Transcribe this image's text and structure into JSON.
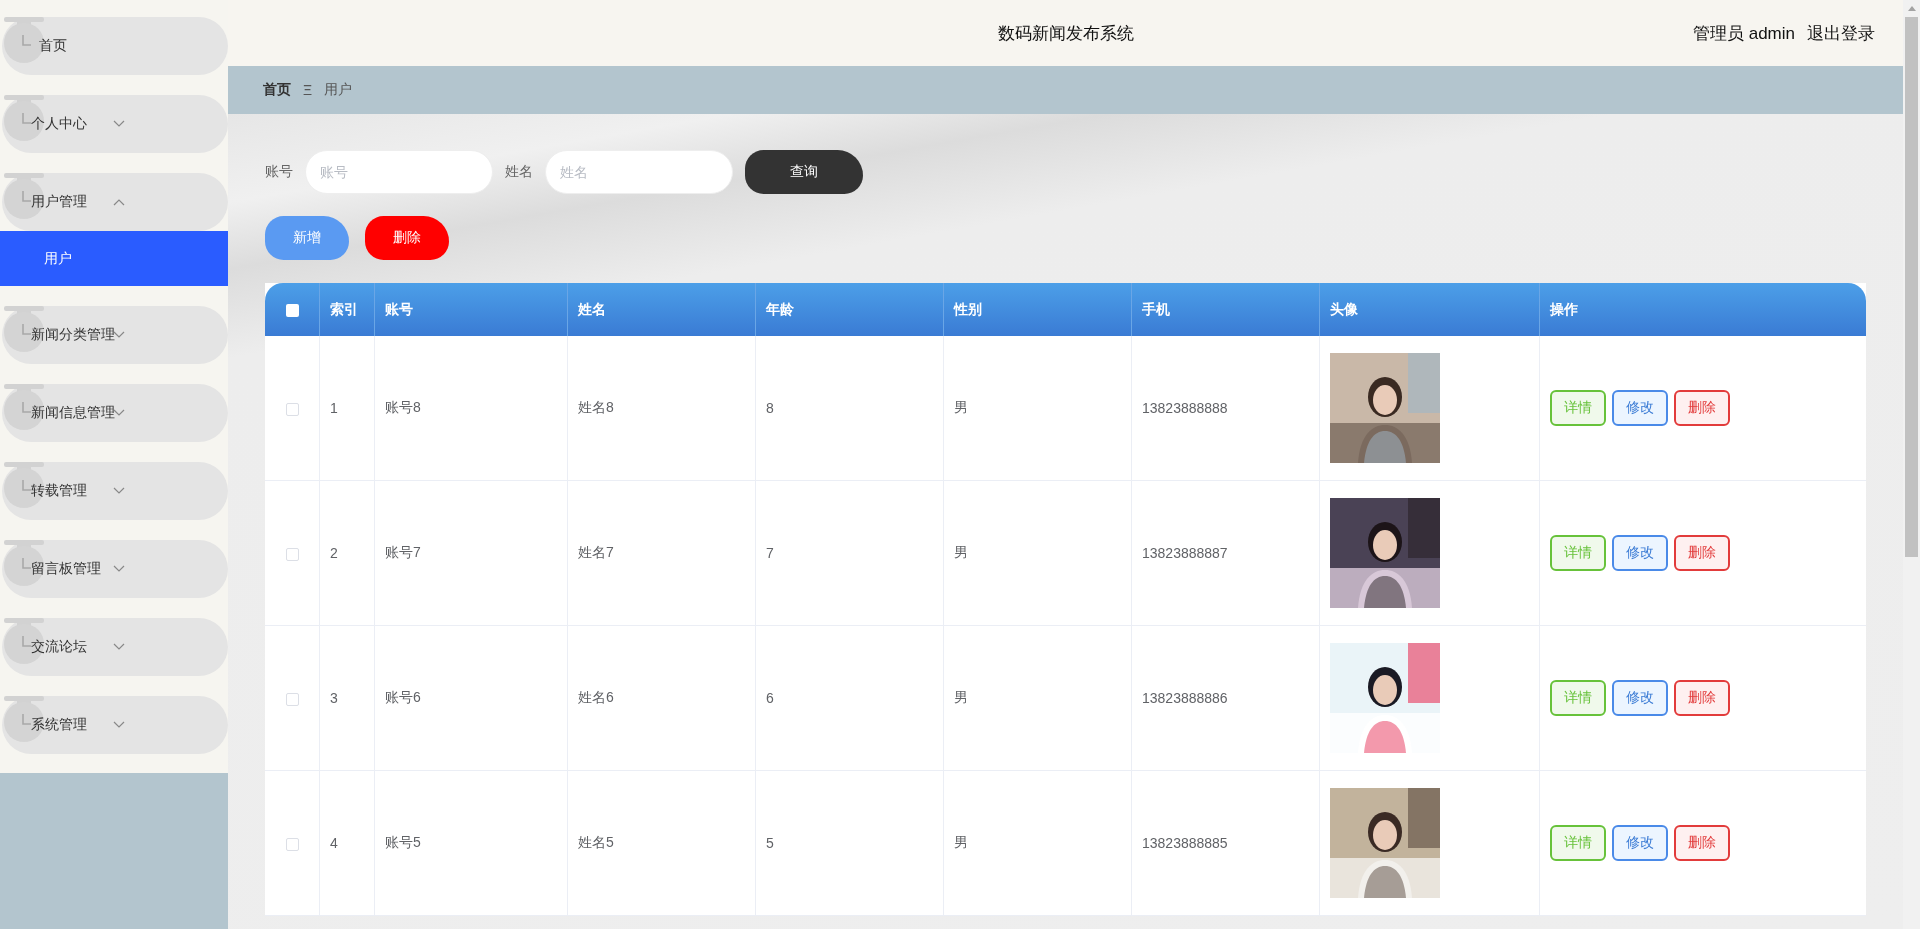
{
  "sidebar": {
    "items": [
      {
        "label": "首页",
        "kind": "link"
      },
      {
        "label": "个人中心",
        "kind": "submenu",
        "expanded": false
      },
      {
        "label": "用户管理",
        "kind": "submenu",
        "expanded": true,
        "children": [
          {
            "label": "用户",
            "selected": true
          }
        ]
      },
      {
        "label": "新闻分类管理",
        "kind": "submenu",
        "expanded": false
      },
      {
        "label": "新闻信息管理",
        "kind": "submenu",
        "expanded": false
      },
      {
        "label": "转载管理",
        "kind": "submenu",
        "expanded": false
      },
      {
        "label": "留言板管理",
        "kind": "submenu",
        "expanded": false
      },
      {
        "label": "交流论坛",
        "kind": "submenu",
        "expanded": false
      },
      {
        "label": "系统管理",
        "kind": "submenu",
        "expanded": false
      }
    ]
  },
  "header": {
    "title": "数码新闻发布系统",
    "user": "管理员 admin",
    "logout": "退出登录"
  },
  "breadcrumb": {
    "items": [
      "首页",
      "用户"
    ],
    "separator": "Ξ"
  },
  "search": {
    "fields": [
      {
        "label": "账号",
        "placeholder": "账号"
      },
      {
        "label": "姓名",
        "placeholder": "姓名"
      }
    ],
    "button": {
      "label": "查询",
      "kind": "query"
    }
  },
  "actions": [
    {
      "label": "新增",
      "kind": "add"
    },
    {
      "label": "删除",
      "kind": "delete"
    }
  ],
  "table": {
    "select_all": {
      "checked": false
    },
    "columns": [
      "索引",
      "账号",
      "姓名",
      "年龄",
      "性别",
      "手机",
      "头像",
      "操作"
    ],
    "rows": [
      {
        "checked": false,
        "cells": [
          "1",
          "账号8",
          "姓名8",
          "8",
          "男",
          "13823888888"
        ],
        "avatar": {
          "kind": "picture"
        },
        "buttons": [
          {
            "label": "详情",
            "kind": "detail"
          },
          {
            "label": "修改",
            "kind": "edit"
          },
          {
            "label": "删除",
            "kind": "delete"
          }
        ]
      },
      {
        "checked": false,
        "cells": [
          "2",
          "账号7",
          "姓名7",
          "7",
          "男",
          "13823888887"
        ],
        "avatar": {
          "kind": "picture"
        },
        "buttons": [
          {
            "label": "详情",
            "kind": "detail"
          },
          {
            "label": "修改",
            "kind": "edit"
          },
          {
            "label": "删除",
            "kind": "delete"
          }
        ]
      },
      {
        "checked": false,
        "cells": [
          "3",
          "账号6",
          "姓名6",
          "6",
          "男",
          "13823888886"
        ],
        "avatar": {
          "kind": "picture"
        },
        "buttons": [
          {
            "label": "详情",
            "kind": "detail"
          },
          {
            "label": "修改",
            "kind": "edit"
          },
          {
            "label": "删除",
            "kind": "delete"
          }
        ]
      },
      {
        "checked": false,
        "cells": [
          "4",
          "账号5",
          "姓名5",
          "5",
          "男",
          "13823888885"
        ],
        "avatar": {
          "kind": "picture"
        },
        "buttons": [
          {
            "label": "详情",
            "kind": "detail"
          },
          {
            "label": "修改",
            "kind": "edit"
          },
          {
            "label": "删除",
            "kind": "delete"
          }
        ]
      }
    ]
  }
}
